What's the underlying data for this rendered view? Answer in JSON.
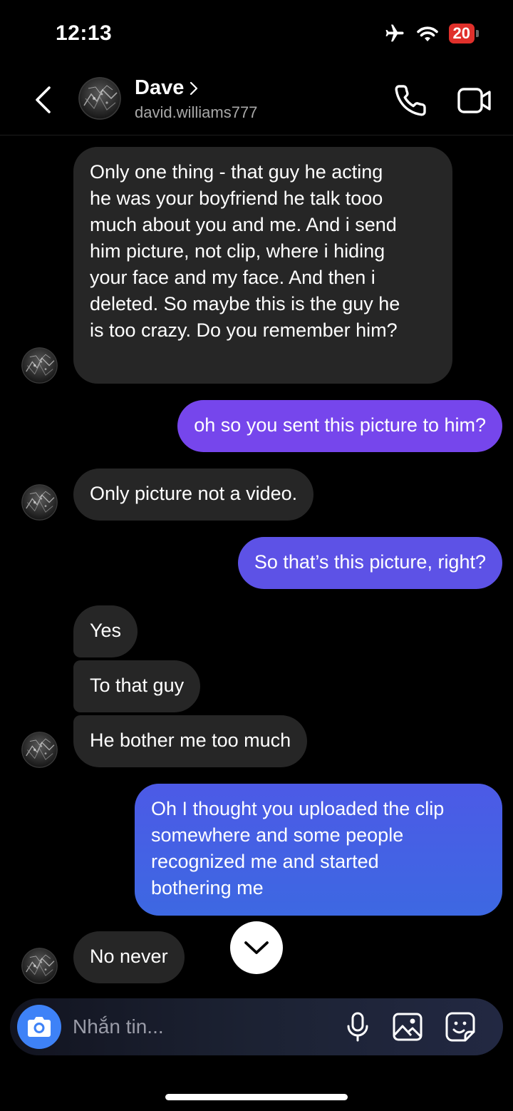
{
  "status_bar": {
    "time": "12:13",
    "battery": "20",
    "icons": [
      "airplane-icon",
      "wifi-icon",
      "battery-icon"
    ]
  },
  "header": {
    "contact_name": "Dave",
    "contact_handle": "david.williams777",
    "icons": [
      "chevron-left-icon",
      "chevron-right-icon",
      "phone-icon",
      "video-camera-icon"
    ]
  },
  "messages": [
    {
      "sender": "them",
      "lines": [
        "Only one thing - that guy he acting",
        "he was your boyfriend he talk tooo",
        "much about you and me. And i send",
        "him picture, not clip, where i hiding",
        "your face and my face. And then i",
        "deleted. So maybe this is the guy he",
        "is too crazy. Do you remember him?"
      ]
    },
    {
      "sender": "me",
      "lines": [
        "oh so you sent this picture to him?"
      ]
    },
    {
      "sender": "them",
      "lines": [
        "Only picture not a video."
      ]
    },
    {
      "sender": "me",
      "lines": [
        "So that’s this picture, right?"
      ]
    },
    {
      "sender": "them",
      "lines": [
        "Yes"
      ]
    },
    {
      "sender": "them",
      "lines": [
        "To that guy"
      ]
    },
    {
      "sender": "them",
      "lines": [
        "He bother me too much"
      ]
    },
    {
      "sender": "me",
      "lines": [
        "Oh I thought you uploaded the clip",
        "somewhere and some people",
        "recognized me and started",
        "bothering me"
      ]
    },
    {
      "sender": "them",
      "lines": [
        "No never"
      ]
    }
  ],
  "composer": {
    "placeholder": "Nhắn tin...",
    "icons": [
      "camera-icon",
      "microphone-icon",
      "gallery-icon",
      "sticker-icon"
    ]
  },
  "colors": {
    "background": "#000000",
    "incoming_bubble": "#262626",
    "outgoing_bubble_purple": "#7646ec",
    "outgoing_bubble_indigo": "#5d52e6",
    "outgoing_bubble_blue": "#3d68e2",
    "camera_button": "#3e82f7",
    "battery_low": "#e0302b"
  }
}
